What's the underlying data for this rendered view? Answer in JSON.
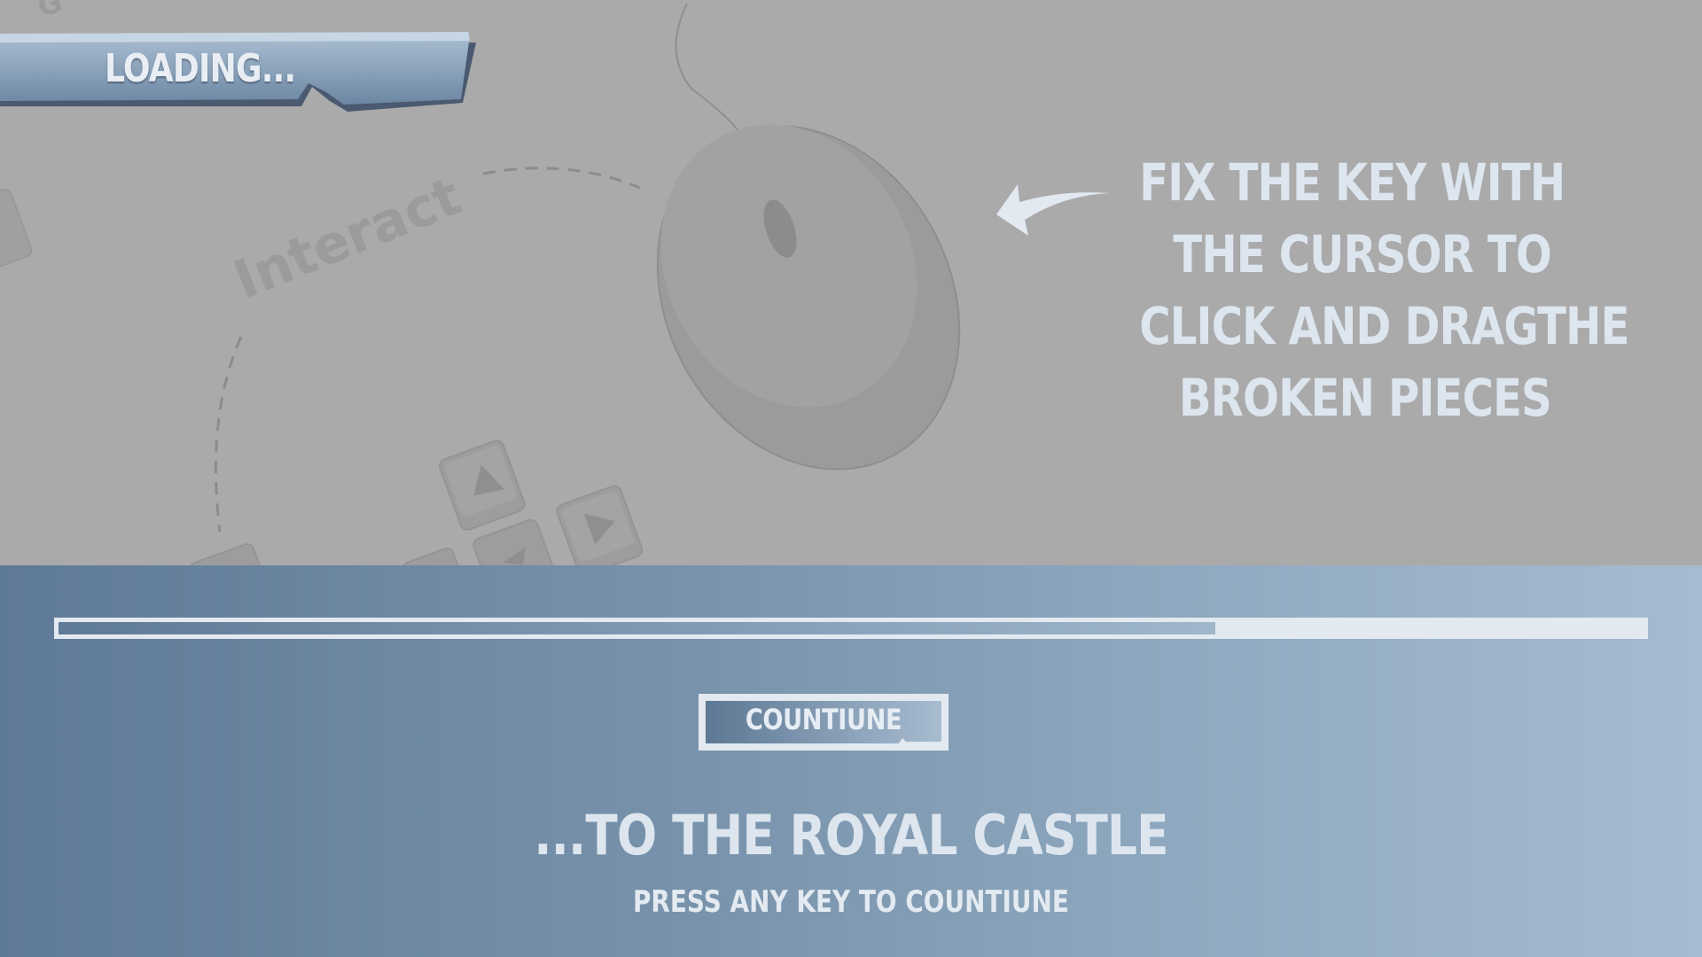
{
  "loading_banner": {
    "text": "LOADING..."
  },
  "background_art": {
    "interact_label": "Interact"
  },
  "instruction": {
    "lines": [
      "FIX THE KEY WITH",
      "THE CURSOR TO",
      "CLICK AND DRAGTHE",
      "BROKEN PIECES"
    ]
  },
  "progress": {
    "value": 0.73
  },
  "continue_button": {
    "label": "COUNTIUNE"
  },
  "destination_title": "...TO THE ROYAL CASTLE",
  "prompt": "PRESS ANY KEY TO COUNTIUNE",
  "colors": {
    "panel_gradient_start": "#5f7a97",
    "panel_gradient_end": "#a7bbd0",
    "text_light": "#dde6ef",
    "background_gray": "#aaaaaa"
  },
  "icons": [
    "mouse-icon",
    "arrow-icon",
    "keyboard-key-icon"
  ]
}
